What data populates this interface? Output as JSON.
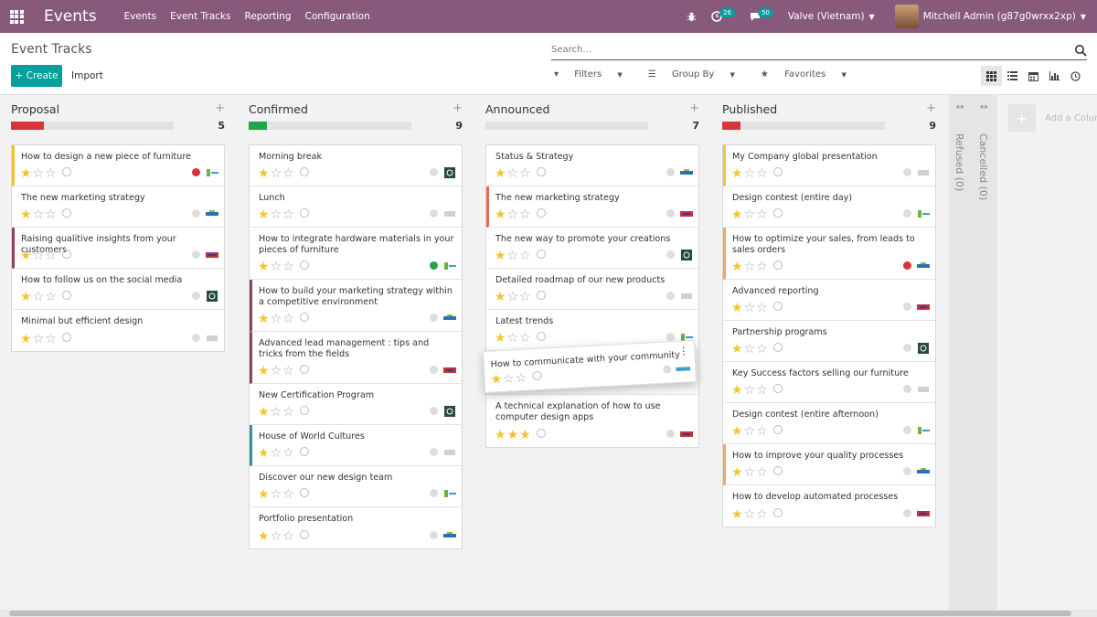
{
  "topbar": {
    "brand": "Events",
    "menu": [
      "Events",
      "Event Tracks",
      "Reporting",
      "Configuration"
    ],
    "activity_count": "26",
    "messages_count": "50",
    "company": "Valve (Vietnam)",
    "user": "Mitchell Admin (g87g0wrxx2xp)",
    "color": "#875a7b"
  },
  "control": {
    "breadcrumb": "Event Tracks",
    "create_label": "+ Create",
    "import_label": "Import",
    "search_placeholder": "Search...",
    "filters_label": "Filters",
    "group_by_label": "Group By",
    "favorites_label": "Favorites"
  },
  "columns": [
    {
      "title": "Proposal",
      "count": "5",
      "progress": [
        {
          "color": "#d9343a",
          "pct": 20
        }
      ],
      "cards": [
        {
          "title": "How to design a new piece of furniture",
          "stars": 1,
          "status": "red",
          "border": "yel"
        },
        {
          "title": "The new marketing strategy",
          "stars": 1,
          "status": "grey",
          "border": ""
        },
        {
          "title": "Raising qualitive insights from your customers",
          "stars": 1,
          "status": "grey",
          "border": "pur"
        },
        {
          "title": "How to follow us on the social media",
          "stars": 1,
          "status": "grey",
          "border": ""
        },
        {
          "title": "Minimal but efficient design",
          "stars": 1,
          "status": "grey",
          "border": ""
        }
      ]
    },
    {
      "title": "Confirmed",
      "count": "9",
      "progress": [
        {
          "color": "#21a548",
          "pct": 11
        }
      ],
      "cards": [
        {
          "title": "Morning break",
          "stars": 1,
          "status": "grey",
          "border": ""
        },
        {
          "title": "Lunch",
          "stars": 1,
          "status": "grey",
          "border": ""
        },
        {
          "title": "How to integrate hardware materials in your pieces of furniture",
          "stars": 1,
          "status": "green",
          "border": "",
          "tall": true
        },
        {
          "title": "How to build your marketing strategy within a competitive environment",
          "stars": 1,
          "status": "grey",
          "border": "pur",
          "tall": true
        },
        {
          "title": "Advanced lead management : tips and tricks from the fields",
          "stars": 1,
          "status": "grey",
          "border": "pur",
          "tall": true
        },
        {
          "title": "New Certification Program",
          "stars": 1,
          "status": "grey",
          "border": ""
        },
        {
          "title": "House of World Cultures",
          "stars": 1,
          "status": "grey",
          "border": "teal"
        },
        {
          "title": "Discover our new design team",
          "stars": 1,
          "status": "grey",
          "border": ""
        },
        {
          "title": "Portfolio presentation",
          "stars": 1,
          "status": "grey",
          "border": ""
        }
      ]
    },
    {
      "title": "Announced",
      "count": "7",
      "progress": [],
      "cards": [
        {
          "title": "Status & Strategy",
          "stars": 1,
          "status": "grey",
          "border": ""
        },
        {
          "title": "The new marketing strategy",
          "stars": 1,
          "status": "grey",
          "border": "red"
        },
        {
          "title": "The new way to promote your creations",
          "stars": 1,
          "status": "grey",
          "border": ""
        },
        {
          "title": "Detailed roadmap of our new products",
          "stars": 1,
          "status": "grey",
          "border": ""
        },
        {
          "title": "Latest trends",
          "stars": 1,
          "status": "grey",
          "border": ""
        },
        {
          "title": "",
          "stars": 0,
          "status": "none",
          "border": "",
          "blank": true
        },
        {
          "title": "A technical explanation of how to use computer design apps",
          "stars": 3,
          "status": "grey",
          "border": "",
          "tall": true
        }
      ]
    },
    {
      "title": "Published",
      "count": "9",
      "progress": [
        {
          "color": "#d9343a",
          "pct": 11
        }
      ],
      "cards": [
        {
          "title": "My Company global presentation",
          "stars": 1,
          "status": "grey",
          "border": "yel"
        },
        {
          "title": "Design contest (entire day)",
          "stars": 1,
          "status": "grey",
          "border": ""
        },
        {
          "title": "How to optimize your sales, from leads to sales orders",
          "stars": 1,
          "status": "red",
          "border": "ora",
          "tall": true
        },
        {
          "title": "Advanced reporting",
          "stars": 1,
          "status": "grey",
          "border": ""
        },
        {
          "title": "Partnership programs",
          "stars": 1,
          "status": "grey",
          "border": ""
        },
        {
          "title": "Key Success factors selling our furniture",
          "stars": 1,
          "status": "grey",
          "border": ""
        },
        {
          "title": "Design contest (entire afternoon)",
          "stars": 1,
          "status": "grey",
          "border": ""
        },
        {
          "title": "How to improve your quality processes",
          "stars": 1,
          "status": "grey",
          "border": "ora"
        },
        {
          "title": "How to develop automated processes",
          "stars": 1,
          "status": "grey",
          "border": ""
        }
      ]
    }
  ],
  "dragging_card": {
    "title": "How to communicate with your community",
    "stars": 1
  },
  "folded_columns": [
    {
      "label": "Refused (0)"
    },
    {
      "label": "Cancelled (0)"
    }
  ],
  "add_column_label": "Add a Column"
}
